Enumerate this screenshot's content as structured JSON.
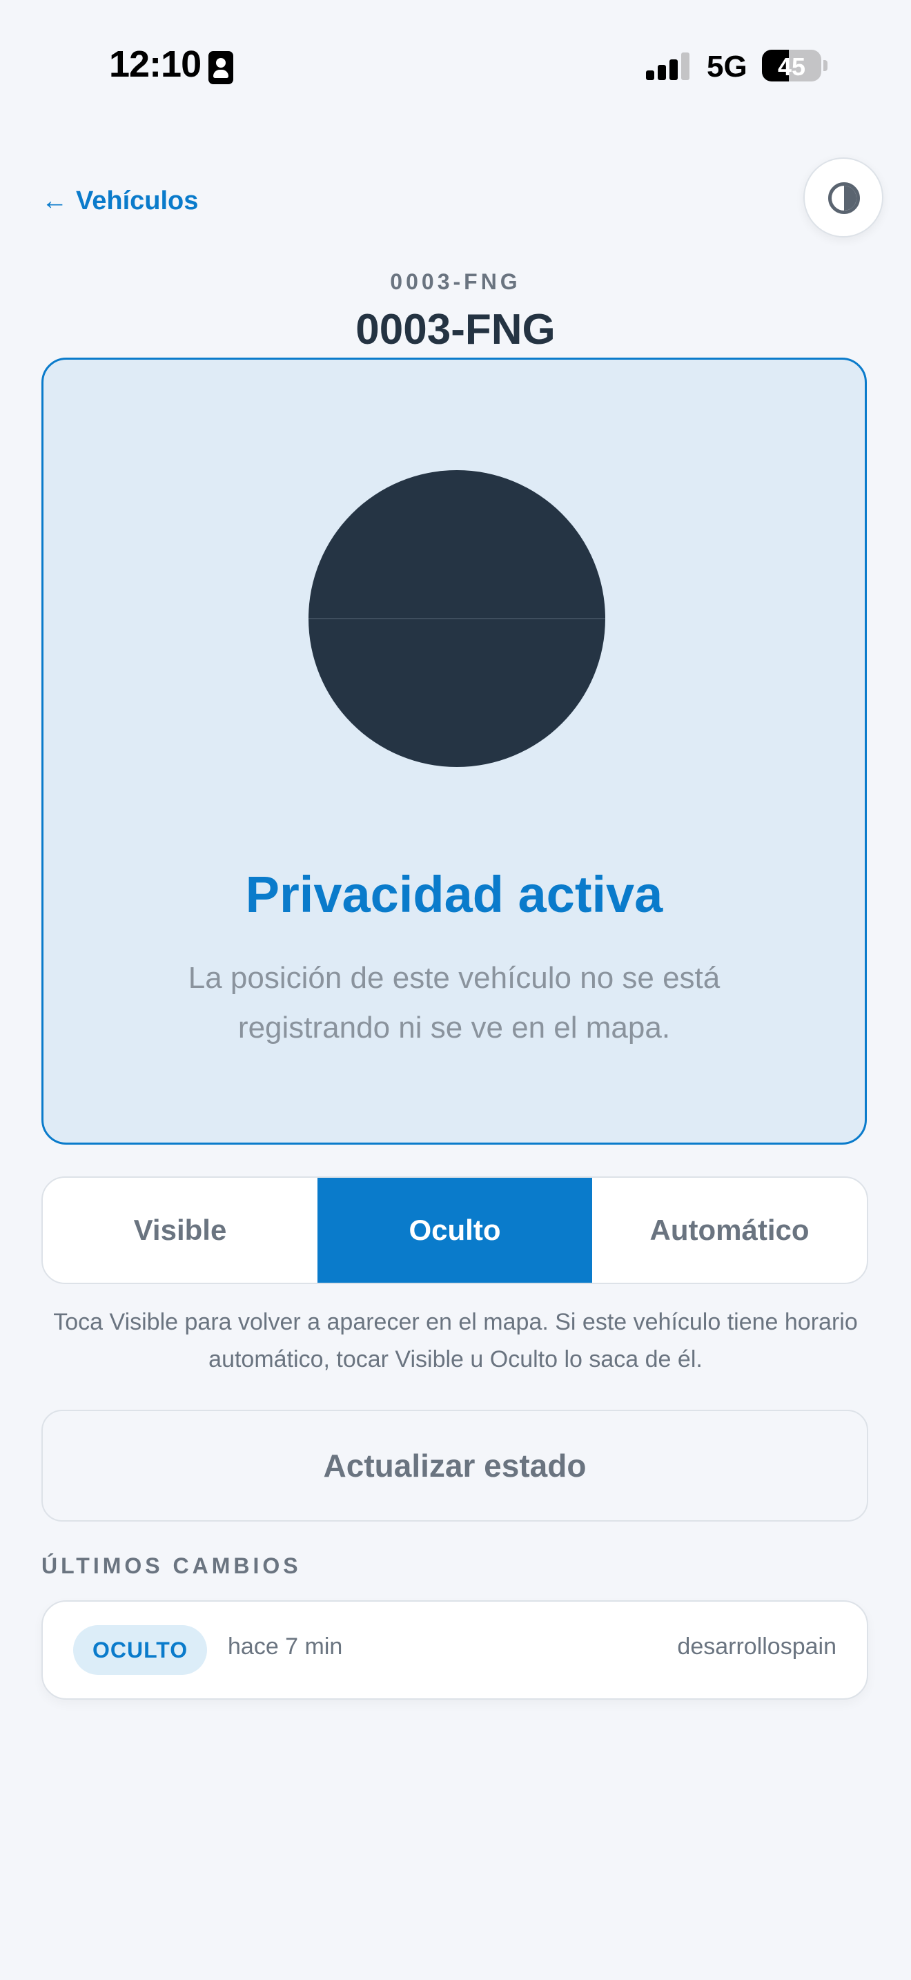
{
  "status_bar": {
    "time": "12:10",
    "network": "5G",
    "battery": "45",
    "battery_level": 0.45
  },
  "nav": {
    "back_label": "Vehículos",
    "back_icon": "arrow-left-icon",
    "theme_icon": "contrast-icon"
  },
  "vehicle": {
    "plate_small": "0003-FNG",
    "plate": "0003-FNG"
  },
  "status_card": {
    "heading": "Privacidad activa",
    "description": "La posición de este vehículo no se está registrando ni se ve en el mapa.",
    "accent_color": "#0a7bcb"
  },
  "mode_selector": {
    "options": [
      "Visible",
      "Oculto",
      "Automático"
    ],
    "selected": "Oculto"
  },
  "help_text": "Toca Visible para volver a aparecer en el mapa. Si este vehículo tiene horario automático, tocar Visible u Oculto lo saca de él.",
  "refresh_button": "Actualizar estado",
  "recent_changes": {
    "title": "ÚLTIMOS CAMBIOS",
    "items": [
      {
        "status": "OCULTO",
        "time": "hace 7 min",
        "user": "desarrollospain"
      }
    ]
  }
}
